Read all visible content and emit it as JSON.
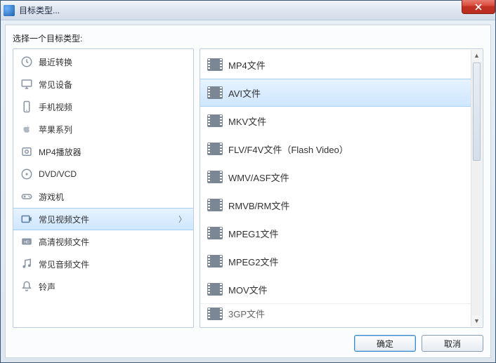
{
  "window": {
    "title": "目标类型..."
  },
  "prompt": "选择一个目标类型:",
  "categories": [
    {
      "id": "recent",
      "label": "最近转换"
    },
    {
      "id": "devices",
      "label": "常见设备"
    },
    {
      "id": "mobile",
      "label": "手机视频"
    },
    {
      "id": "apple",
      "label": "苹果系列"
    },
    {
      "id": "mp4",
      "label": "MP4播放器"
    },
    {
      "id": "dvd",
      "label": "DVD/VCD"
    },
    {
      "id": "game",
      "label": "游戏机"
    },
    {
      "id": "video",
      "label": "常见视频文件",
      "selected": true
    },
    {
      "id": "hd",
      "label": "高清视频文件"
    },
    {
      "id": "audio",
      "label": "常见音频文件"
    },
    {
      "id": "ringtone",
      "label": "铃声"
    }
  ],
  "formats": [
    {
      "label": "MP4文件"
    },
    {
      "label": "AVI文件",
      "selected": true
    },
    {
      "label": "MKV文件"
    },
    {
      "label": "FLV/F4V文件（Flash Video）"
    },
    {
      "label": "WMV/ASF文件"
    },
    {
      "label": "RMVB/RM文件"
    },
    {
      "label": "MPEG1文件"
    },
    {
      "label": "MPEG2文件"
    },
    {
      "label": "MOV文件"
    }
  ],
  "peek_label": "3GP文件",
  "buttons": {
    "ok": "确定",
    "cancel": "取消"
  }
}
